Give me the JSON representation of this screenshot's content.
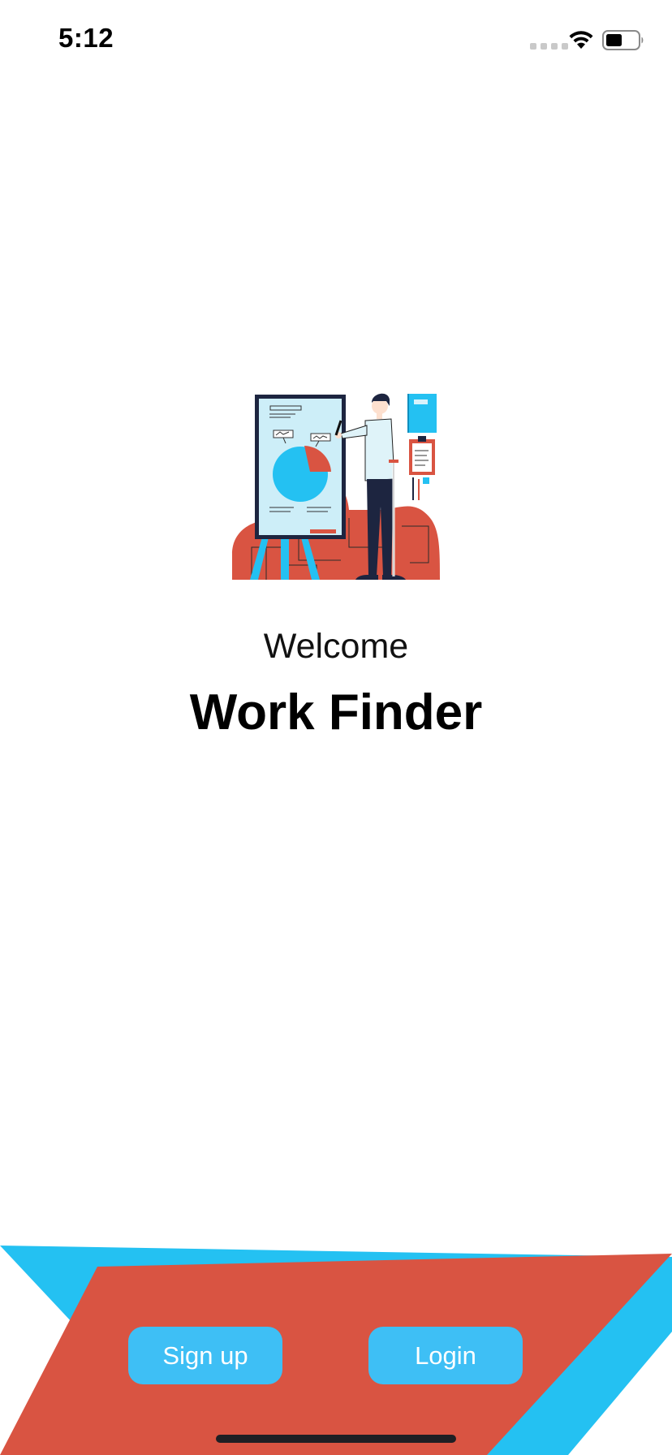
{
  "status_bar": {
    "time": "5:12",
    "icons": [
      "cellular-signal-icon",
      "wifi-icon",
      "battery-icon"
    ]
  },
  "hero": {
    "illustration": "presentation-illustration",
    "welcome": "Welcome",
    "title": "Work Finder"
  },
  "actions": {
    "signup_label": "Sign up",
    "login_label": "Login"
  },
  "colors": {
    "accent_blue": "#24c1f2",
    "button_blue": "#3ebff5",
    "accent_red": "#d95442",
    "navy": "#1d2540"
  }
}
